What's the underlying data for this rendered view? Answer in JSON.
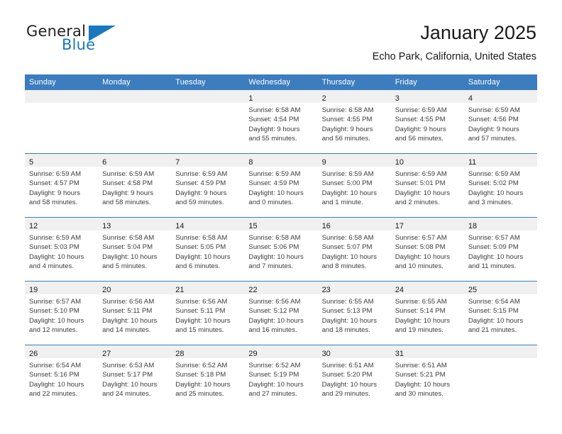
{
  "brand": {
    "name_part1": "General",
    "name_part2": "Blue",
    "triangle_icon": "triangle-icon",
    "accent_color": "#1878be"
  },
  "header": {
    "title": "January 2025",
    "location": "Echo Park, California, United States"
  },
  "theme": {
    "header_blue": "#3b7dbf",
    "date_strip_gray": "#f0f0f0",
    "text_color": "#3c3c3c"
  },
  "calendar": {
    "weekday_headers": [
      "Sunday",
      "Monday",
      "Tuesday",
      "Wednesday",
      "Thursday",
      "Friday",
      "Saturday"
    ],
    "weeks": [
      [
        {
          "empty": true
        },
        {
          "empty": true
        },
        {
          "empty": true
        },
        {
          "day": "1",
          "sunrise": "Sunrise: 6:58 AM",
          "sunset": "Sunset: 4:54 PM",
          "daylight1": "Daylight: 9 hours",
          "daylight2": "and 55 minutes."
        },
        {
          "day": "2",
          "sunrise": "Sunrise: 6:58 AM",
          "sunset": "Sunset: 4:55 PM",
          "daylight1": "Daylight: 9 hours",
          "daylight2": "and 56 minutes."
        },
        {
          "day": "3",
          "sunrise": "Sunrise: 6:59 AM",
          "sunset": "Sunset: 4:55 PM",
          "daylight1": "Daylight: 9 hours",
          "daylight2": "and 56 minutes."
        },
        {
          "day": "4",
          "sunrise": "Sunrise: 6:59 AM",
          "sunset": "Sunset: 4:56 PM",
          "daylight1": "Daylight: 9 hours",
          "daylight2": "and 57 minutes."
        }
      ],
      [
        {
          "day": "5",
          "sunrise": "Sunrise: 6:59 AM",
          "sunset": "Sunset: 4:57 PM",
          "daylight1": "Daylight: 9 hours",
          "daylight2": "and 58 minutes."
        },
        {
          "day": "6",
          "sunrise": "Sunrise: 6:59 AM",
          "sunset": "Sunset: 4:58 PM",
          "daylight1": "Daylight: 9 hours",
          "daylight2": "and 58 minutes."
        },
        {
          "day": "7",
          "sunrise": "Sunrise: 6:59 AM",
          "sunset": "Sunset: 4:59 PM",
          "daylight1": "Daylight: 9 hours",
          "daylight2": "and 59 minutes."
        },
        {
          "day": "8",
          "sunrise": "Sunrise: 6:59 AM",
          "sunset": "Sunset: 4:59 PM",
          "daylight1": "Daylight: 10 hours",
          "daylight2": "and 0 minutes."
        },
        {
          "day": "9",
          "sunrise": "Sunrise: 6:59 AM",
          "sunset": "Sunset: 5:00 PM",
          "daylight1": "Daylight: 10 hours",
          "daylight2": "and 1 minute."
        },
        {
          "day": "10",
          "sunrise": "Sunrise: 6:59 AM",
          "sunset": "Sunset: 5:01 PM",
          "daylight1": "Daylight: 10 hours",
          "daylight2": "and 2 minutes."
        },
        {
          "day": "11",
          "sunrise": "Sunrise: 6:59 AM",
          "sunset": "Sunset: 5:02 PM",
          "daylight1": "Daylight: 10 hours",
          "daylight2": "and 3 minutes."
        }
      ],
      [
        {
          "day": "12",
          "sunrise": "Sunrise: 6:59 AM",
          "sunset": "Sunset: 5:03 PM",
          "daylight1": "Daylight: 10 hours",
          "daylight2": "and 4 minutes."
        },
        {
          "day": "13",
          "sunrise": "Sunrise: 6:58 AM",
          "sunset": "Sunset: 5:04 PM",
          "daylight1": "Daylight: 10 hours",
          "daylight2": "and 5 minutes."
        },
        {
          "day": "14",
          "sunrise": "Sunrise: 6:58 AM",
          "sunset": "Sunset: 5:05 PM",
          "daylight1": "Daylight: 10 hours",
          "daylight2": "and 6 minutes."
        },
        {
          "day": "15",
          "sunrise": "Sunrise: 6:58 AM",
          "sunset": "Sunset: 5:06 PM",
          "daylight1": "Daylight: 10 hours",
          "daylight2": "and 7 minutes."
        },
        {
          "day": "16",
          "sunrise": "Sunrise: 6:58 AM",
          "sunset": "Sunset: 5:07 PM",
          "daylight1": "Daylight: 10 hours",
          "daylight2": "and 8 minutes."
        },
        {
          "day": "17",
          "sunrise": "Sunrise: 6:57 AM",
          "sunset": "Sunset: 5:08 PM",
          "daylight1": "Daylight: 10 hours",
          "daylight2": "and 10 minutes."
        },
        {
          "day": "18",
          "sunrise": "Sunrise: 6:57 AM",
          "sunset": "Sunset: 5:09 PM",
          "daylight1": "Daylight: 10 hours",
          "daylight2": "and 11 minutes."
        }
      ],
      [
        {
          "day": "19",
          "sunrise": "Sunrise: 6:57 AM",
          "sunset": "Sunset: 5:10 PM",
          "daylight1": "Daylight: 10 hours",
          "daylight2": "and 12 minutes."
        },
        {
          "day": "20",
          "sunrise": "Sunrise: 6:56 AM",
          "sunset": "Sunset: 5:11 PM",
          "daylight1": "Daylight: 10 hours",
          "daylight2": "and 14 minutes."
        },
        {
          "day": "21",
          "sunrise": "Sunrise: 6:56 AM",
          "sunset": "Sunset: 5:11 PM",
          "daylight1": "Daylight: 10 hours",
          "daylight2": "and 15 minutes."
        },
        {
          "day": "22",
          "sunrise": "Sunrise: 6:56 AM",
          "sunset": "Sunset: 5:12 PM",
          "daylight1": "Daylight: 10 hours",
          "daylight2": "and 16 minutes."
        },
        {
          "day": "23",
          "sunrise": "Sunrise: 6:55 AM",
          "sunset": "Sunset: 5:13 PM",
          "daylight1": "Daylight: 10 hours",
          "daylight2": "and 18 minutes."
        },
        {
          "day": "24",
          "sunrise": "Sunrise: 6:55 AM",
          "sunset": "Sunset: 5:14 PM",
          "daylight1": "Daylight: 10 hours",
          "daylight2": "and 19 minutes."
        },
        {
          "day": "25",
          "sunrise": "Sunrise: 6:54 AM",
          "sunset": "Sunset: 5:15 PM",
          "daylight1": "Daylight: 10 hours",
          "daylight2": "and 21 minutes."
        }
      ],
      [
        {
          "day": "26",
          "sunrise": "Sunrise: 6:54 AM",
          "sunset": "Sunset: 5:16 PM",
          "daylight1": "Daylight: 10 hours",
          "daylight2": "and 22 minutes."
        },
        {
          "day": "27",
          "sunrise": "Sunrise: 6:53 AM",
          "sunset": "Sunset: 5:17 PM",
          "daylight1": "Daylight: 10 hours",
          "daylight2": "and 24 minutes."
        },
        {
          "day": "28",
          "sunrise": "Sunrise: 6:52 AM",
          "sunset": "Sunset: 5:18 PM",
          "daylight1": "Daylight: 10 hours",
          "daylight2": "and 25 minutes."
        },
        {
          "day": "29",
          "sunrise": "Sunrise: 6:52 AM",
          "sunset": "Sunset: 5:19 PM",
          "daylight1": "Daylight: 10 hours",
          "daylight2": "and 27 minutes."
        },
        {
          "day": "30",
          "sunrise": "Sunrise: 6:51 AM",
          "sunset": "Sunset: 5:20 PM",
          "daylight1": "Daylight: 10 hours",
          "daylight2": "and 29 minutes."
        },
        {
          "day": "31",
          "sunrise": "Sunrise: 6:51 AM",
          "sunset": "Sunset: 5:21 PM",
          "daylight1": "Daylight: 10 hours",
          "daylight2": "and 30 minutes."
        },
        {
          "empty": true
        }
      ]
    ]
  }
}
